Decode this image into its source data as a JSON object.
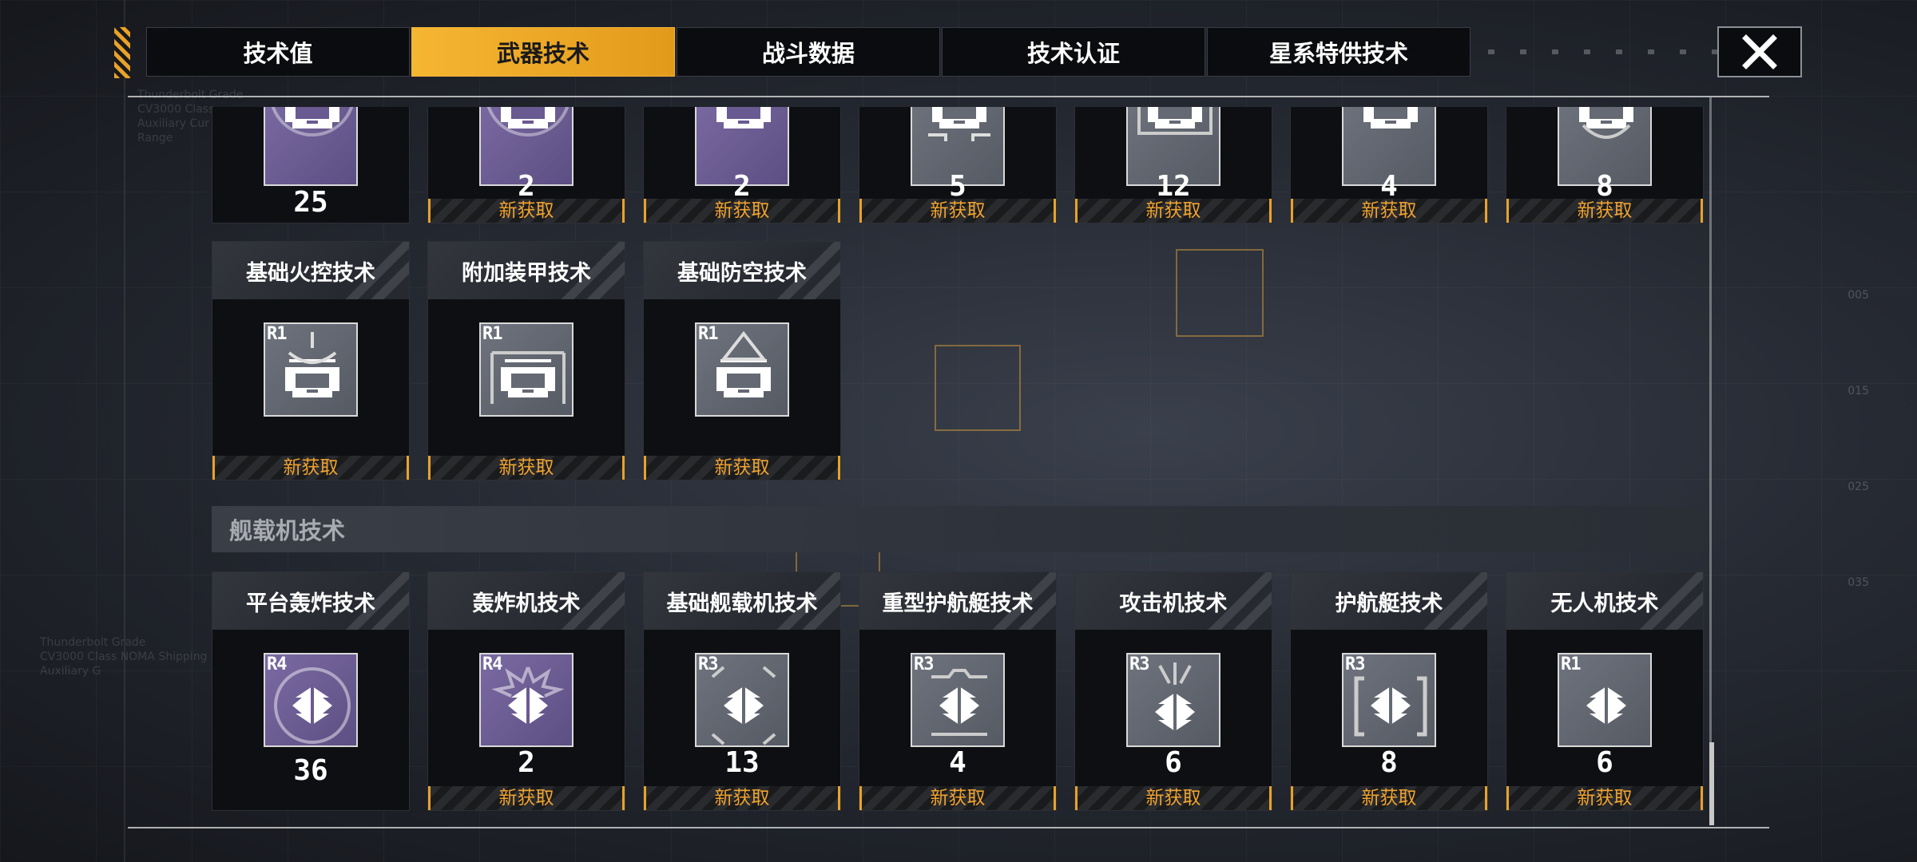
{
  "tabs": [
    {
      "label": "技术值",
      "active": false
    },
    {
      "label": "武器技术",
      "active": true
    },
    {
      "label": "战斗数据",
      "active": false
    },
    {
      "label": "技术认证",
      "active": false
    },
    {
      "label": "星系特供技术",
      "active": false
    }
  ],
  "close_icon": "close-icon",
  "accent_color": "#f0a330",
  "top_row": [
    {
      "count": "25",
      "badge": "",
      "color": "purple"
    },
    {
      "count": "2",
      "badge": "新获取",
      "color": "purple"
    },
    {
      "count": "2",
      "badge": "新获取",
      "color": "purple"
    },
    {
      "count": "5",
      "badge": "新获取",
      "color": "grey"
    },
    {
      "count": "12",
      "badge": "新获取",
      "color": "grey"
    },
    {
      "count": "4",
      "badge": "新获取",
      "color": "grey"
    },
    {
      "count": "8",
      "badge": "新获取",
      "color": "grey"
    }
  ],
  "middle_row": [
    {
      "title": "基础火控技术",
      "rank": "R1",
      "badge": "新获取"
    },
    {
      "title": "附加装甲技术",
      "rank": "R1",
      "badge": "新获取"
    },
    {
      "title": "基础防空技术",
      "rank": "R1",
      "badge": "新获取"
    }
  ],
  "section": {
    "title": "舰载机技术"
  },
  "bottom_row": [
    {
      "title": "平台轰炸技术",
      "rank": "R4",
      "count": "36",
      "badge": "",
      "color": "purple"
    },
    {
      "title": "轰炸机技术",
      "rank": "R4",
      "count": "2",
      "badge": "新获取",
      "color": "purple"
    },
    {
      "title": "基础舰载机技术",
      "rank": "R3",
      "count": "13",
      "badge": "新获取",
      "color": "grey"
    },
    {
      "title": "重型护航艇技术",
      "rank": "R3",
      "count": "4",
      "badge": "新获取",
      "color": "grey"
    },
    {
      "title": "攻击机技术",
      "rank": "R3",
      "count": "6",
      "badge": "新获取",
      "color": "grey"
    },
    {
      "title": "护航艇技术",
      "rank": "R3",
      "count": "8",
      "badge": "新获取",
      "color": "grey"
    },
    {
      "title": "无人机技术",
      "rank": "R1",
      "count": "6",
      "badge": "新获取",
      "color": "grey"
    }
  ],
  "background_text": {
    "top_left": "Thunderbolt Grade\nCV3000 Class\nAuxiliary Cur\nRange",
    "mid_left": "Thunderbolt Grade\nCV3000 Class NOMA Shipping D\nAuxiliary G",
    "right_ticks": [
      "005",
      "015",
      "025",
      "035"
    ]
  }
}
